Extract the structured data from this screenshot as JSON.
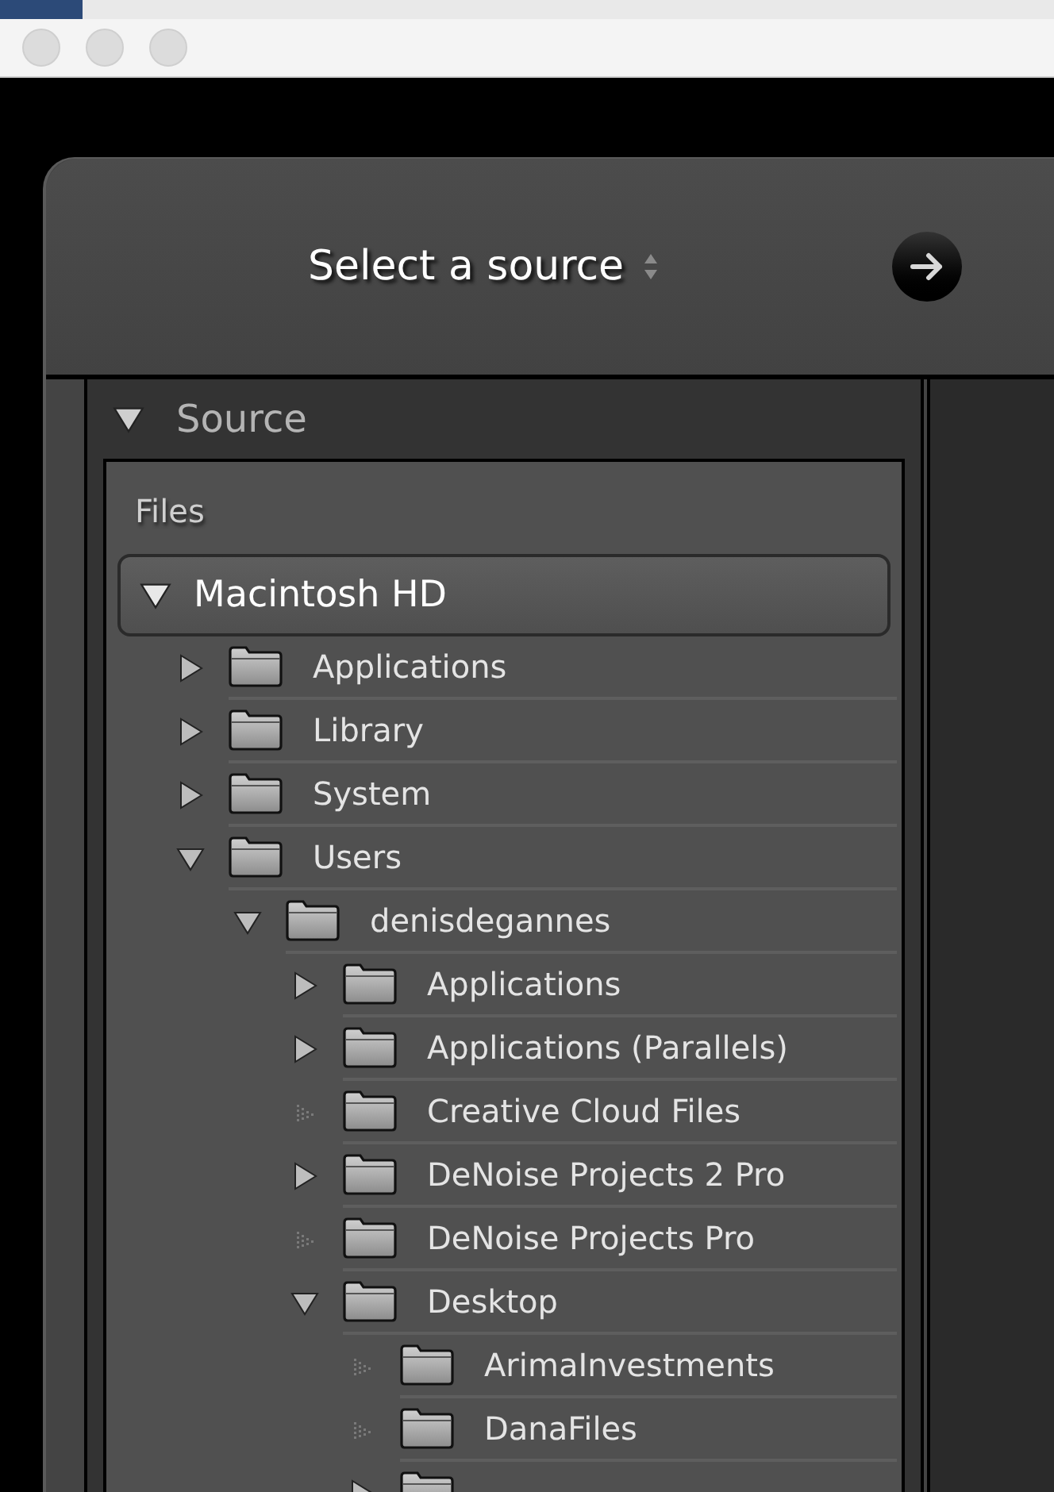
{
  "dialog": {
    "title": "Select a source",
    "source_panel": {
      "title": "Source",
      "expanded": true,
      "section": "Files",
      "volume": {
        "name": "Macintosh HD",
        "expanded": true,
        "children": [
          {
            "name": "Applications",
            "has_children": true,
            "expanded": false
          },
          {
            "name": "Library",
            "has_children": true,
            "expanded": false
          },
          {
            "name": "System",
            "has_children": true,
            "expanded": false
          },
          {
            "name": "Users",
            "has_children": true,
            "expanded": true,
            "children": [
              {
                "name": "denisdegannes",
                "has_children": true,
                "expanded": true,
                "children": [
                  {
                    "name": "Applications",
                    "has_children": true,
                    "expanded": false
                  },
                  {
                    "name": "Applications (Parallels)",
                    "has_children": true,
                    "expanded": false
                  },
                  {
                    "name": "Creative Cloud Files",
                    "has_children": false,
                    "expanded": false
                  },
                  {
                    "name": "DeNoise Projects 2 Pro",
                    "has_children": true,
                    "expanded": false
                  },
                  {
                    "name": "DeNoise Projects Pro",
                    "has_children": false,
                    "expanded": false
                  },
                  {
                    "name": "Desktop",
                    "has_children": true,
                    "expanded": true,
                    "children": [
                      {
                        "name": "ArimaInvestments",
                        "has_children": false,
                        "expanded": false
                      },
                      {
                        "name": "DanaFiles",
                        "has_children": false,
                        "expanded": false
                      },
                      {
                        "has_children": true,
                        "expanded": false
                      }
                    ]
                  }
                ]
              }
            ]
          }
        ]
      }
    }
  }
}
